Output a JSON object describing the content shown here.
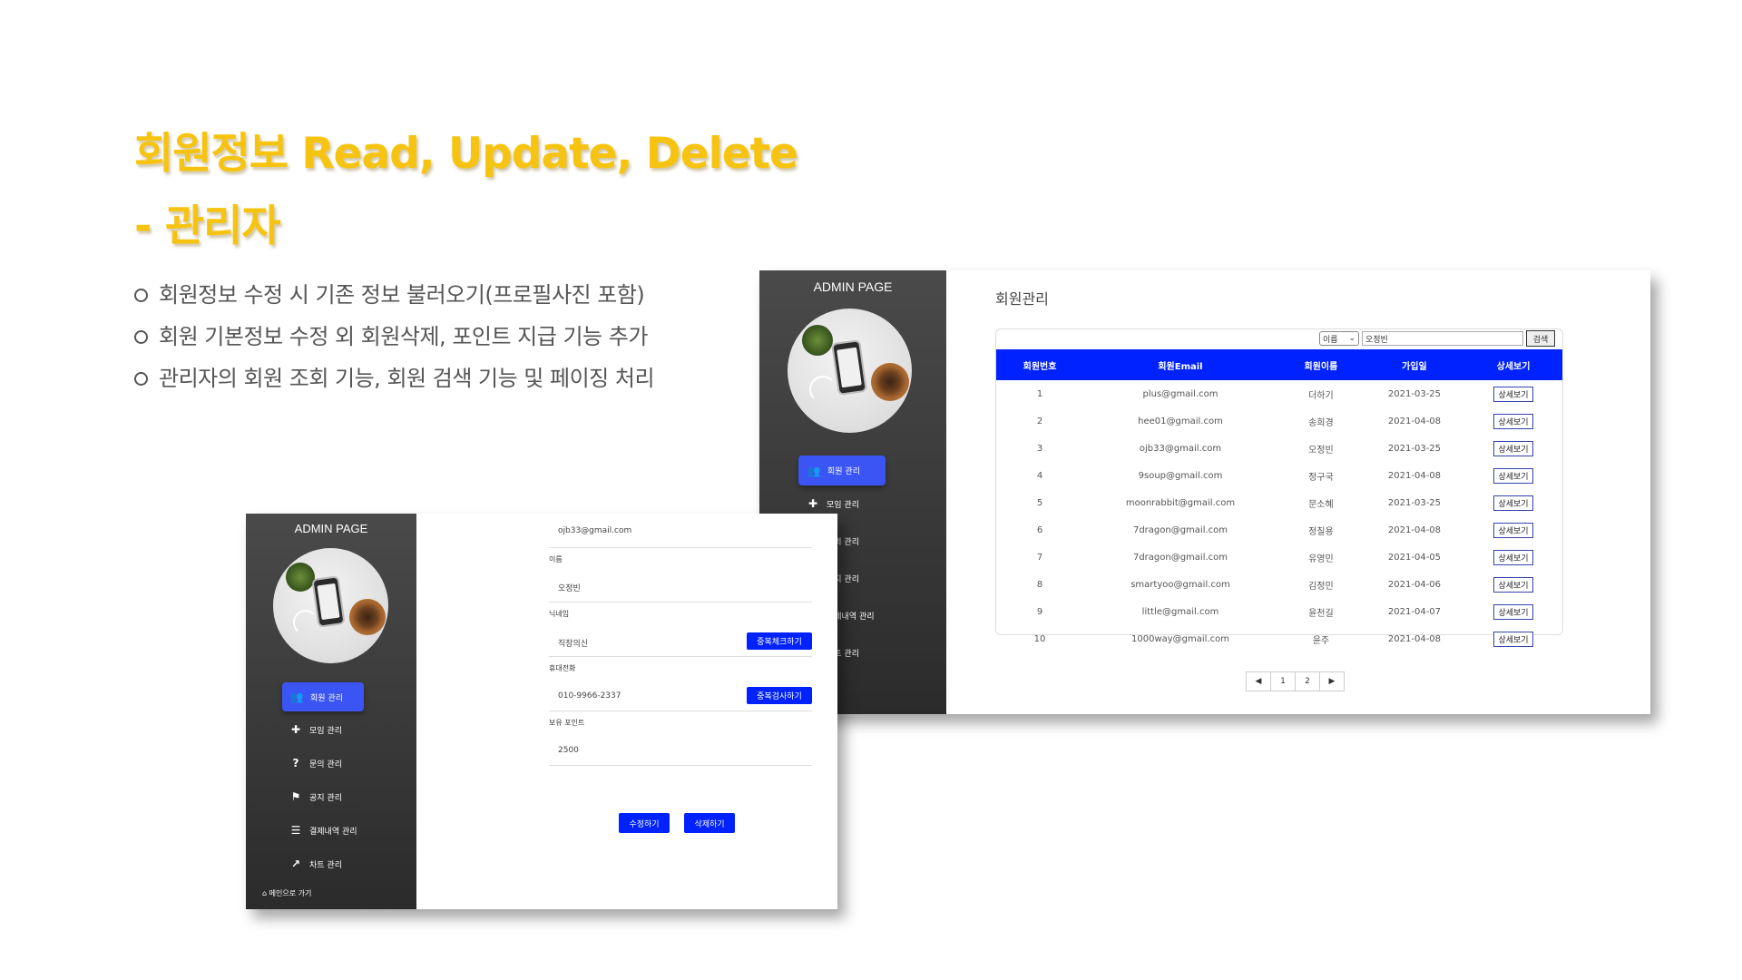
{
  "slide": {
    "title_line1": "회원정보 Read, Update, Delete",
    "title_line2": "- 관리자",
    "bullets": [
      "회원정보 수정 시 기존 정보 불러오기(프로필사진 포함)",
      "회원 기본정보 수정 외 회원삭제, 포인트 지급 기능 추가",
      "관리자의 회원 조회 기능, 회원 검색 기능 및 페이징 처리"
    ],
    "title_color": "#f6c410"
  },
  "list_window": {
    "sidebar_title": "ADMIN PAGE",
    "menu": [
      {
        "label": "회원 관리",
        "icon": "users-icon",
        "active": true
      },
      {
        "label": "모임 관리",
        "icon": "plus-icon"
      },
      {
        "label": "문의 관리",
        "icon": "question-icon"
      },
      {
        "label": "공지 관리",
        "icon": "flag-icon"
      },
      {
        "label": "결제내역 관리",
        "icon": "payment-icon"
      },
      {
        "label": "차트 관리",
        "icon": "chart-icon"
      }
    ],
    "page_heading": "회원관리",
    "search": {
      "select_value": "이름",
      "input_value": "오정빈",
      "button_label": "검색"
    },
    "columns": [
      "회원번호",
      "회원Email",
      "회원이름",
      "가입일",
      "상세보기"
    ],
    "rows": [
      {
        "no": "1",
        "email": "plus@gmail.com",
        "name": "더하기",
        "date": "2021-03-25",
        "action": "상세보기"
      },
      {
        "no": "2",
        "email": "hee01@gmail.com",
        "name": "송희경",
        "date": "2021-04-08",
        "action": "상세보기"
      },
      {
        "no": "3",
        "email": "ojb33@gmail.com",
        "name": "오정빈",
        "date": "2021-03-25",
        "action": "상세보기"
      },
      {
        "no": "4",
        "email": "9soup@gmail.com",
        "name": "정구국",
        "date": "2021-04-08",
        "action": "상세보기"
      },
      {
        "no": "5",
        "email": "moonrabbit@gmail.com",
        "name": "문소혜",
        "date": "2021-03-25",
        "action": "상세보기"
      },
      {
        "no": "6",
        "email": "7dragon@gmail.com",
        "name": "정칠용",
        "date": "2021-04-08",
        "action": "상세보기"
      },
      {
        "no": "7",
        "email": "7dragon@gmail.com",
        "name": "유영민",
        "date": "2021-04-05",
        "action": "상세보기"
      },
      {
        "no": "8",
        "email": "smartyoo@gmail.com",
        "name": "김정민",
        "date": "2021-04-06",
        "action": "상세보기"
      },
      {
        "no": "9",
        "email": "little@gmail.com",
        "name": "윤천길",
        "date": "2021-04-07",
        "action": "상세보기"
      },
      {
        "no": "10",
        "email": "1000way@gmail.com",
        "name": "윤주",
        "date": "2021-04-08",
        "action": "상세보기"
      }
    ],
    "pager": {
      "prev": "◀",
      "pages": [
        "1",
        "2"
      ],
      "next": "▶"
    },
    "header_color": "#0022ff"
  },
  "edit_window": {
    "sidebar_title": "ADMIN PAGE",
    "menu": [
      {
        "label": "회원 관리",
        "icon": "users-icon",
        "active": true
      },
      {
        "label": "모임 관리",
        "icon": "plus-icon"
      },
      {
        "label": "문의 관리",
        "icon": "question-icon"
      },
      {
        "label": "공지 관리",
        "icon": "flag-icon"
      },
      {
        "label": "결제내역 관리",
        "icon": "payment-icon"
      },
      {
        "label": "차트 관리",
        "icon": "chart-icon"
      }
    ],
    "home_link": "메인으로 가기",
    "email_value": "ojb33@gmail.com",
    "name_label": "이름",
    "name_value": "오정빈",
    "nickname_label": "닉네임",
    "nickname_value": "직장의신",
    "nickname_check": "중복체크하기",
    "phone_label": "휴대전화",
    "phone_value": "010-9966-2337",
    "phone_check": "중복검사하기",
    "points_label": "보유 포인트",
    "points_value": "2500",
    "update_button": "수정하기",
    "delete_button": "삭제하기"
  }
}
